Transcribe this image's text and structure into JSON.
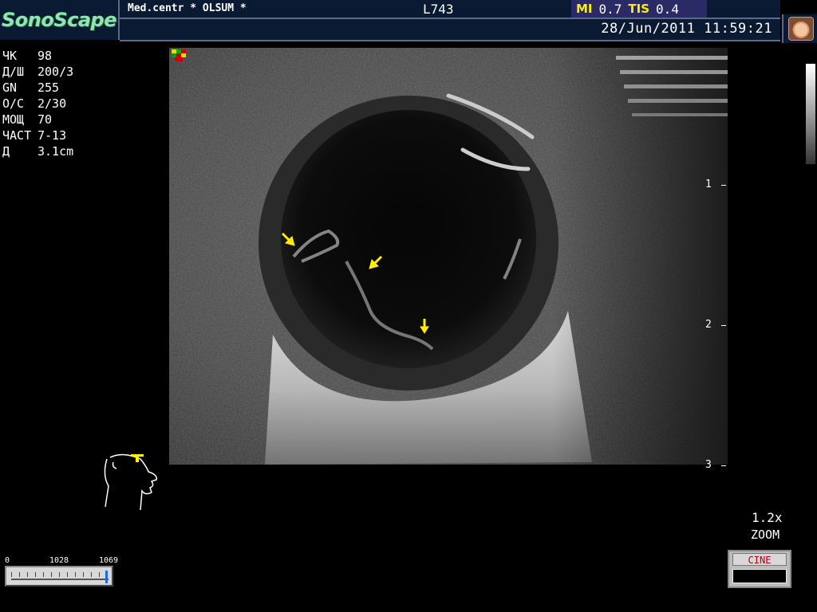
{
  "header": {
    "logo": "SonoScape",
    "hospital": "Med.centr * OLSUM *",
    "probe": "L743",
    "mi_label": "MI",
    "mi_value": "0.7",
    "tis_label": "TIS",
    "tis_value": "0.4",
    "datetime": "28/Jun/2011 11:59:21"
  },
  "params": [
    {
      "key": "ЧК",
      "value": "98"
    },
    {
      "key": "Д/Ш",
      "value": "200/3"
    },
    {
      "key": "GN",
      "value": "255"
    },
    {
      "key": "О/С",
      "value": "2/30"
    },
    {
      "key": "МОЩ",
      "value": "70"
    },
    {
      "key": "ЧАСТ",
      "value": "7-13"
    },
    {
      "key": "Д",
      "value": "3.1cm"
    }
  ],
  "depth_scale": [
    "1",
    "2",
    "3"
  ],
  "slider": {
    "min": "0",
    "mid": "1028",
    "max": "1069",
    "position": 1.0
  },
  "zoom": {
    "value": "1.2x",
    "label": "ZOOM"
  },
  "cine": {
    "label": "CINE"
  },
  "colors": {
    "header_bg": "#0a1a33",
    "logo": "#8ee6b0",
    "mi_tis_label": "#ffee00",
    "arrow": "#ffee00",
    "cine_text": "#b00000"
  },
  "icons": [
    "orientation-marker-icon",
    "patient-avatar-icon",
    "head-body-marker-icon",
    "annotation-arrow-icon"
  ]
}
